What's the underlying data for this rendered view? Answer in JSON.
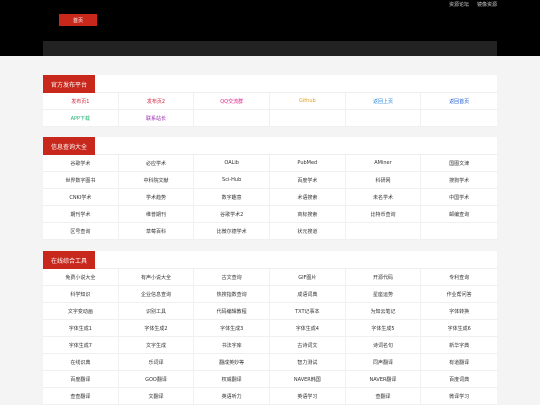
{
  "header": {
    "top_links": [
      "资源论坛",
      "镜像资源"
    ],
    "home_label": "首页"
  },
  "sections": {
    "official": {
      "title": "官方发布平台",
      "items": [
        {
          "label": "发布页1",
          "color": "#d0233c"
        },
        {
          "label": "发布页2",
          "color": "#d0233c"
        },
        {
          "label": "QQ交流群",
          "color": "#e0208a"
        },
        {
          "label": "Github",
          "color": "#e0a020"
        },
        {
          "label": "返回上页",
          "color": "#1e88e5"
        },
        {
          "label": "返回首页",
          "color": "#1e5bd8"
        },
        {
          "label": "APP下载",
          "color": "#20b070"
        },
        {
          "label": "联系站长",
          "color": "#9c27b0"
        }
      ]
    },
    "info": {
      "title": "信息查询大全",
      "items": [
        "谷歌学术",
        "必应学术",
        "OALib",
        "PubMed",
        "AMiner",
        "国图文津",
        "世界数字图书",
        "中科院文献",
        "Sci-Hub",
        "百度学术",
        "科研网",
        "搜狗学术",
        "CNKI学术",
        "学术趋势",
        "数字趣意",
        "术语搜索",
        "未名学术",
        "中国学术",
        "期刊学术",
        "维普期刊",
        "谷歌学术2",
        "商标搜索",
        "比特币查询",
        "邮编查询",
        "区号查询",
        "草莓百科",
        "比微尔德学术",
        "状元搜道"
      ]
    },
    "tools": {
      "title": "在线综合工具",
      "items": [
        "免费小说大全",
        "有声小说大全",
        "古文查询",
        "GIF图片",
        "开源代码",
        "专利查询",
        "科学知识",
        "企业信息查询",
        "热搜指数查询",
        "成语词典",
        "星座运势",
        "作业帮问答",
        "文字变动画",
        "识别工具",
        "代码编辑教程",
        "TXT记事本",
        "为知云笔记",
        "字体转换",
        "字体生成1",
        "字体生成2",
        "字体生成3",
        "字体生成4",
        "字体生成5",
        "字体生成6",
        "字体生成7",
        "文字生成",
        "书法字库",
        "古诗词文",
        "诗词名句",
        "新华字典",
        "在线识典",
        "乐词译",
        "翻成英妙等",
        "智力测试",
        "同声翻译",
        "有道翻译",
        "百度翻译",
        "GOO翻译",
        "权威翻译",
        "NAVER韩国",
        "NAVER翻译",
        "百度词典",
        "查查翻译",
        "文翻译",
        "英语听力",
        "英语学习",
        "查翻译",
        "微译学习"
      ]
    }
  }
}
